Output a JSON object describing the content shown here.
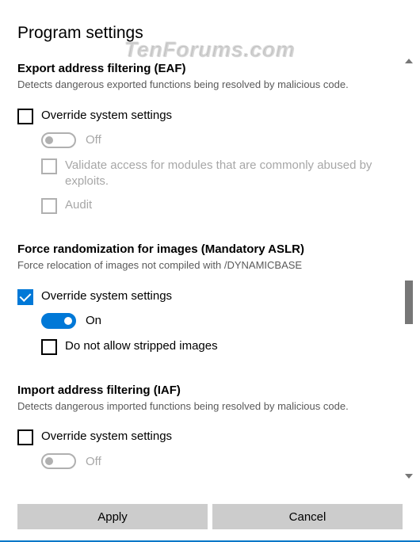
{
  "watermark": "TenForums.com",
  "title": "Program settings",
  "sections": {
    "eaf": {
      "heading": "Export address filtering (EAF)",
      "desc": "Detects dangerous exported functions being resolved by malicious code.",
      "override_label": "Override system settings",
      "override_checked": false,
      "toggle_state": "Off",
      "opt_validate": "Validate access for modules that are commonly abused by exploits.",
      "opt_audit": "Audit"
    },
    "aslr": {
      "heading": "Force randomization for images (Mandatory ASLR)",
      "desc": "Force relocation of images not compiled with /DYNAMICBASE",
      "override_label": "Override system settings",
      "override_checked": true,
      "toggle_state": "On",
      "opt_strip": "Do not allow stripped images"
    },
    "iaf": {
      "heading": "Import address filtering (IAF)",
      "desc": "Detects dangerous imported functions being resolved by malicious code.",
      "override_label": "Override system settings",
      "override_checked": false,
      "toggle_state": "Off"
    }
  },
  "buttons": {
    "apply": "Apply",
    "cancel": "Cancel"
  }
}
